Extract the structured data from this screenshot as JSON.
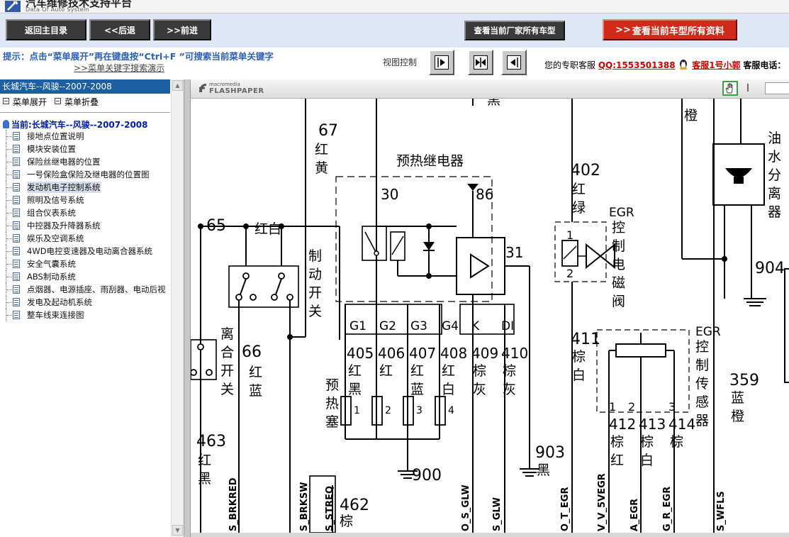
{
  "header": {
    "title": "汽车维修技术支持平台",
    "subtitle": "Data Of Auto System"
  },
  "toolbar": {
    "home": "返回主目录",
    "back": "<<后退",
    "forward": ">>前进",
    "manufacturer_models": "查看当前厂家所有车型",
    "model_all_data": "查看当前车型所有资料"
  },
  "hint": {
    "text": "提示：点击“菜单展开”再在键盘按“Ctrl+F ”可搜索当前菜单关键字",
    "link": ">>菜单关键字搜索演示"
  },
  "view_control": {
    "label": "视图控制"
  },
  "service": {
    "prefix": "您的专职客服",
    "qq": "QQ:1553501388",
    "agent": "客服1号小郭",
    "phone_label": "客服电话："
  },
  "sidebar": {
    "title": "长城汽车--风骏--2007-2008",
    "expand": "菜单展开",
    "collapse": "菜单折叠",
    "current": "当前:长城汽车--风骏--2007-2008",
    "items": [
      "接地点位置说明",
      "模块安装位置",
      "保险丝继电器的位置",
      "一号保险盒保险及继电器的位置图",
      "发动机电子控制系统",
      "照明及信号系统",
      "组合仪表系统",
      "中控器及升降器系统",
      "娱乐及空调系统",
      "4WD电控变速器及电动离合器系统",
      "安全气囊系统",
      "ABS制动系统",
      "点烟器、电源插座、雨刮器、电动后视",
      "发电及起动机系统",
      "整车线束连接图"
    ],
    "active_index": 4
  },
  "viewer": {
    "brand": "macromedia",
    "name": "FLASHPAPER"
  },
  "diagram": {
    "relay_title": "预热继电器",
    "pins": {
      "p30": "30",
      "p86": "86",
      "p31": "31",
      "g1": "G1",
      "g2": "G2",
      "g3": "G3",
      "g4": "G4",
      "k": "K",
      "di": "DI"
    },
    "wires": {
      "w67": "67",
      "w67c": "红黄",
      "w65": "65",
      "w65c": "红白",
      "w66": "66",
      "w66c": "红蓝",
      "w463": "463",
      "w463c": "红黑",
      "w462": "462",
      "w462c": "棕",
      "w405": "405",
      "w405c": "红黑",
      "w406": "406",
      "w406c": "红",
      "w407": "407",
      "w407c": "红蓝",
      "w408": "408",
      "w408c": "红白",
      "w409": "409",
      "w409c": "棕灰",
      "w410": "410",
      "w410c": "棕灰",
      "w900": "900",
      "w903": "903",
      "w903c": "黑",
      "w402": "402",
      "w402c": "红绿",
      "w411": "411",
      "w411c": "棕白",
      "w412": "412",
      "w412c": "棕红",
      "w413": "413",
      "w413c": "棕白",
      "w414": "414",
      "w414c": "棕",
      "w904": "904",
      "w359": "359",
      "w359c": "蓝橙",
      "top_orange": "橙",
      "top_black": "黑"
    },
    "components": {
      "brake_switch": "制动开关",
      "clutch_switch": "离合开关",
      "glow_plug": "预热塞",
      "egr_valve_a": "EGR",
      "egr_valve_b": "控制电磁阀",
      "egr_sensor_a": "EGR",
      "egr_sensor_b": "控制传感器",
      "water_sep": "油水分离器"
    },
    "plug_numbers": [
      "1",
      "2",
      "3",
      "4"
    ],
    "valve_pins": [
      "1",
      "2"
    ],
    "sensor_pins": [
      "1",
      "2",
      "3"
    ],
    "bottom_signals": [
      "S_BRKRED",
      "S_BRKSW",
      "S_STREQ",
      "O_S_GLW",
      "S_GLW",
      "O_T_EGR",
      "V_V_5VEGR",
      "A_EGR",
      "G_R_EGR",
      "S_WFLS"
    ]
  }
}
